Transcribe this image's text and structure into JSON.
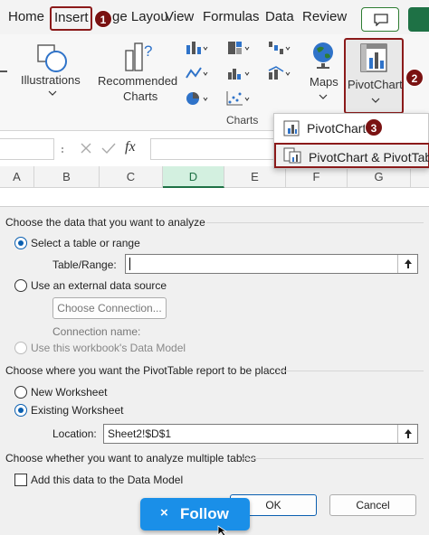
{
  "ribbon_tabs": {
    "home": "Home",
    "insert": "Insert",
    "page_layout": "ge Layou",
    "view": "View",
    "formulas": "Formulas",
    "data": "Data",
    "review": "Review"
  },
  "badges": {
    "one": "1",
    "two": "2",
    "three": "3"
  },
  "ribbon": {
    "illustrations": "Illustrations",
    "recommended_line1": "Recommended",
    "recommended_line2": "Charts",
    "maps": "Maps",
    "pivotchart": "PivotChart",
    "charts_group": "Charts"
  },
  "dropdown": {
    "item1": "PivotChart",
    "item2": "PivotChart & PivotTable"
  },
  "formula_bar": {
    "fx": "fx"
  },
  "columns": [
    "A",
    "B",
    "C",
    "D",
    "E",
    "F",
    "G"
  ],
  "selected_column": "D",
  "dialog": {
    "section1_heading": "Choose the data that you want to analyze",
    "radio_select_table": "Select a table or range",
    "table_range_label": "Table/Range:",
    "table_range_value": "",
    "radio_external": "Use an external data source",
    "choose_connection": "Choose Connection...",
    "connection_name": "Connection name:",
    "radio_data_model": "Use this workbook's Data Model",
    "section2_heading": "Choose where you want the PivotTable report to be placed",
    "radio_new_ws": "New Worksheet",
    "radio_existing_ws": "Existing Worksheet",
    "location_label": "Location:",
    "location_value": "Sheet2!$D$1",
    "section3_heading": "Choose whether you want to analyze multiple tables",
    "add_data_model": "Add this data to the Data Model",
    "ok": "OK",
    "cancel": "Cancel"
  },
  "follow": {
    "icon": "×",
    "label": "Follow"
  },
  "colors": {
    "accent_red": "#8b1a1a",
    "excel_green": "#1e7145",
    "follow_blue": "#1a8fe8"
  }
}
